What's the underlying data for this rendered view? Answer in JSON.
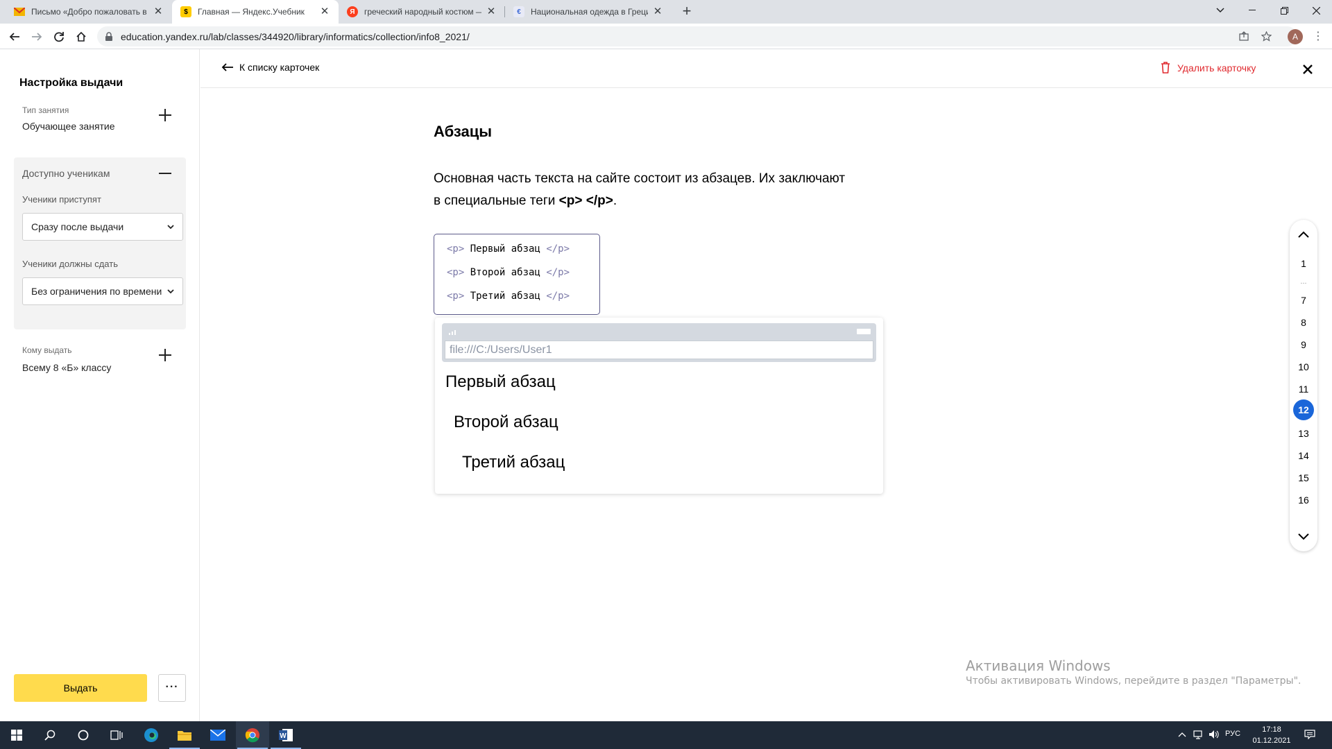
{
  "browser": {
    "tabs": [
      {
        "title": "Письмо «Добро пожаловать в Я",
        "favicon": "mail-icon",
        "color": "#f3b500",
        "active": false
      },
      {
        "title": "Главная — Яндекс.Учебник",
        "favicon": "yandex-uchebnik-icon",
        "color": "#ffcc00",
        "active": true
      },
      {
        "title": "греческий народный костюм —",
        "favicon": "yandex-icon",
        "color": "#fc3f1d",
        "active": false
      },
      {
        "title": "Национальная одежда в Греци",
        "favicon": "site-icon",
        "color": "#3e6bd6",
        "active": false
      }
    ],
    "url": "education.yandex.ru/lab/classes/344920/library/informatics/collection/info8_2021/",
    "profile_initial": "A"
  },
  "sidebar": {
    "title": "Настройка выдачи",
    "lesson_type_label": "Тип занятия",
    "lesson_type_value": "Обучающее занятие",
    "available_label": "Доступно ученикам",
    "start_label": "Ученики приступят",
    "start_value": "Сразу после выдачи",
    "deadline_label": "Ученики должны сдать",
    "deadline_value": "Без ограничения по времени",
    "assign_to_label": "Кому выдать",
    "assign_to_value": "Всему 8 «Б» классу",
    "issue_button": "Выдать",
    "more_button": "···"
  },
  "header": {
    "back_label": "К списку карточек",
    "delete_label": "Удалить карточку"
  },
  "card": {
    "title": "Абзацы",
    "text_line1": "Основная часть текста на сайте состоит из абзацев. Их заключают",
    "text_line2_prefix": "в специальные теги ",
    "text_line2_tags": "<p> </p>",
    "text_line2_suffix": ".",
    "code_lines": [
      {
        "open": "<p>",
        "text": "Первый абзац",
        "close": "</p>"
      },
      {
        "open": "<p>",
        "text": "Второй абзац",
        "close": "</p>"
      },
      {
        "open": "<p>",
        "text": "Третий абзац",
        "close": "</p>"
      }
    ],
    "preview_url": "file:///C:/Users/User1",
    "paragraphs": [
      "Первый абзац",
      "Второй абзац",
      "Третий абзац"
    ]
  },
  "page_nav": {
    "items": [
      "1",
      "...",
      "7",
      "8",
      "9",
      "10",
      "11",
      "12",
      "13",
      "14",
      "15",
      "16"
    ],
    "active": "12"
  },
  "watermark": {
    "title": "Активация Windows",
    "subtitle": "Чтобы активировать Windows, перейдите в раздел \"Параметры\"."
  },
  "taskbar": {
    "language": "РУС",
    "time": "17:18",
    "date": "01.12.2021"
  },
  "colors": {
    "accent_yellow": "#ffdb4d",
    "delete_red": "#e0292e",
    "active_page_blue": "#1a66d9",
    "code_border": "#5c5a8a"
  }
}
